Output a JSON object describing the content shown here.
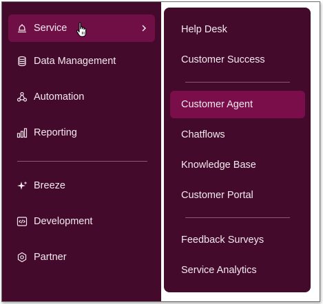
{
  "colors": {
    "panel_bg": "#440a2b",
    "active_item_bg": "#6f0f45",
    "active_sub_bg": "#7a0e4a",
    "text": "#f4e9ef",
    "divider": "#8a5a74"
  },
  "nav": {
    "items": [
      {
        "label": "Service",
        "icon": "bell-icon",
        "active": true
      },
      {
        "label": "Data Management",
        "icon": "database-icon"
      },
      {
        "label": "Automation",
        "icon": "network-icon"
      },
      {
        "label": "Reporting",
        "icon": "bar-chart-icon"
      },
      {
        "label": "Breeze",
        "icon": "sparkle-icon"
      },
      {
        "label": "Development",
        "icon": "code-icon"
      },
      {
        "label": "Partner",
        "icon": "hexagon-icon"
      }
    ]
  },
  "submenu": {
    "group1": [
      "Help Desk",
      "Customer Success"
    ],
    "group2": [
      "Customer Agent",
      "Chatflows",
      "Knowledge Base",
      "Customer Portal"
    ],
    "group3": [
      "Feedback Surveys",
      "Service Analytics"
    ],
    "active": "Customer Agent"
  }
}
